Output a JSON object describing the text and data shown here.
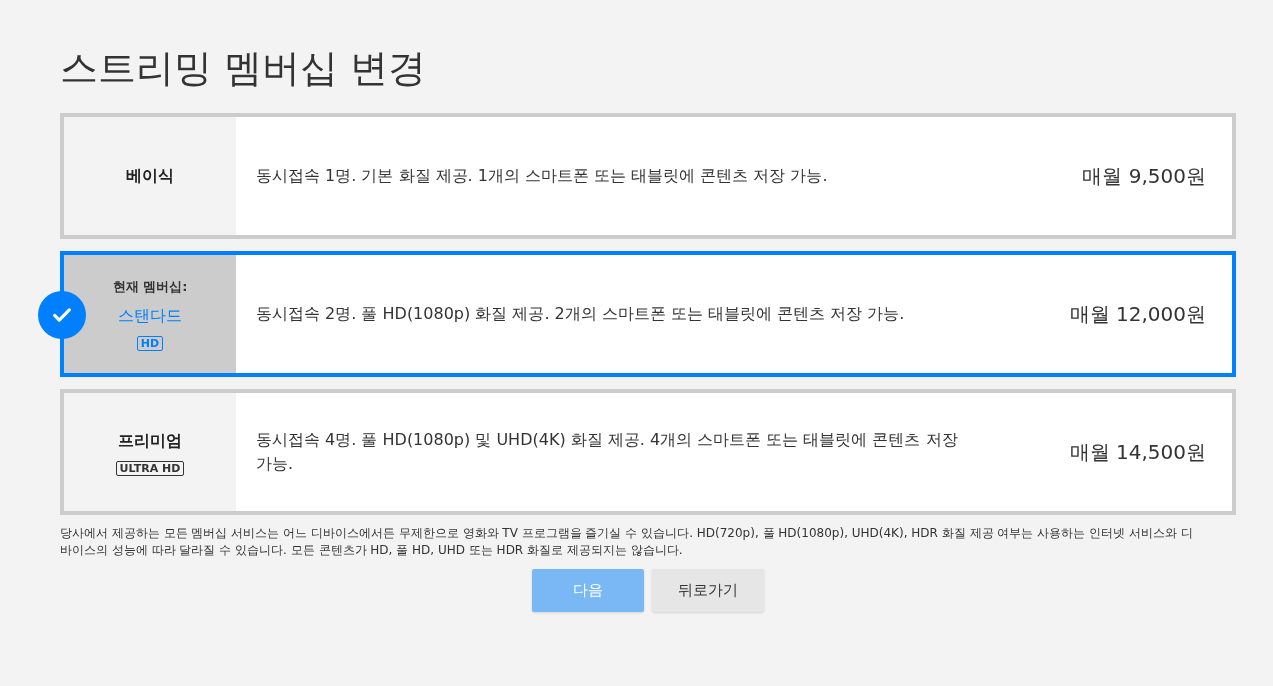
{
  "title": "스트리밍 멤버십 변경",
  "plans": [
    {
      "name": "베이식",
      "selected": false,
      "description": "동시접속 1명. 기본 화질 제공. 1개의 스마트폰 또는 태블릿에 콘텐츠 저장 가능.",
      "price": "매월 9,500원"
    },
    {
      "name": "스탠다드",
      "current_label": "현재 멤버십:",
      "selected": true,
      "badge": "HD",
      "description": "동시접속 2명. 풀 HD(1080p) 화질 제공. 2개의 스마트폰 또는 태블릿에 콘텐츠 저장 가능.",
      "price": "매월 12,000원"
    },
    {
      "name": "프리미엄",
      "selected": false,
      "badge": "ULTRA HD",
      "description": "동시접속 4명. 풀 HD(1080p) 및 UHD(4K) 화질 제공. 4개의 스마트폰 또는 태블릿에 콘텐츠 저장 가능.",
      "price": "매월 14,500원"
    }
  ],
  "disclaimer": "당사에서 제공하는 모든 멤버십 서비스는 어느 디바이스에서든 무제한으로 영화와 TV 프로그램을 즐기실 수 있습니다. HD(720p), 풀 HD(1080p), UHD(4K), HDR 화질 제공 여부는 사용하는 인터넷 서비스와 디바이스의 성능에 따라 달라질 수 있습니다. 모든 콘텐츠가 HD, 풀 HD, UHD 또는 HDR 화질로 제공되지는 않습니다.",
  "buttons": [
    {
      "label": "다음",
      "kind": "primary",
      "disabled": true
    },
    {
      "label": "뒤로가기",
      "kind": "secondary",
      "disabled": false
    }
  ]
}
